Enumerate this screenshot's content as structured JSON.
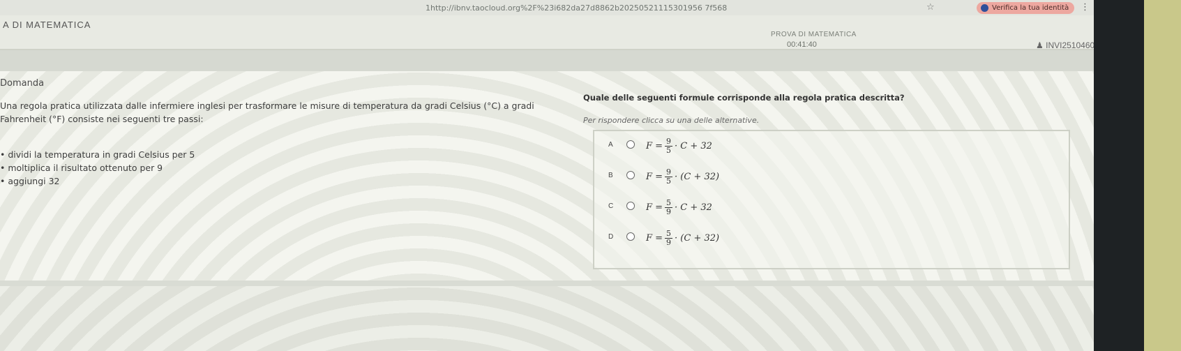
{
  "browser": {
    "url": "1http://ibnv.taocloud.org%2F%23i682da27d8862b20250521115301956 7f568",
    "verify_label": "Verifica la tua identità"
  },
  "header": {
    "app_title": "A DI MATEMATICA",
    "test_title": "PROVA DI MATEMATICA",
    "timer": "00:41:40",
    "user_id": "INVI2510460..."
  },
  "question": {
    "section_label": "Domanda",
    "stem_line1": "Una regola pratica utilizzata dalle infermiere inglesi per trasformare le misure di temperatura da gradi Celsius (°C) a gradi",
    "stem_line2": "Fahrenheit (°F) consiste nei seguenti tre passi:",
    "steps": [
      "dividi la temperatura in gradi Celsius per 5",
      "moltiplica il risultato ottenuto per 9",
      "aggiungi 32"
    ],
    "prompt": "Quale delle seguenti formule corrisponde alla regola pratica descritta?",
    "instruction": "Per rispondere clicca su una delle alternative.",
    "options": [
      {
        "letter": "A",
        "prefix": "F =",
        "num": "9",
        "den": "5",
        "suffix": "· C + 32"
      },
      {
        "letter": "B",
        "prefix": "F =",
        "num": "9",
        "den": "5",
        "suffix": "· (C + 32)"
      },
      {
        "letter": "C",
        "prefix": "F =",
        "num": "5",
        "den": "9",
        "suffix": "· C + 32"
      },
      {
        "letter": "D",
        "prefix": "F =",
        "num": "5",
        "den": "9",
        "suffix": "· (C + 32)"
      }
    ]
  }
}
